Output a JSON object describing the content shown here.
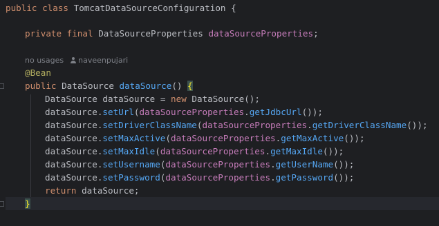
{
  "code": {
    "line1": {
      "kw_public": "public",
      "kw_class": "class",
      "class_name": "TomcatDataSourceConfiguration",
      "brace": "{"
    },
    "line2": {
      "kw_private": "private",
      "kw_final": "final",
      "type": "DataSourceProperties",
      "field": "dataSourceProperties",
      "semi": ";"
    },
    "hint": {
      "usages": "no usages",
      "author": "naveenpujari",
      "author_icon": "person-icon"
    },
    "annotation": "@Bean",
    "method_sig": {
      "kw_public": "public",
      "return_type": "DataSource",
      "method_name": "dataSource",
      "parens": "()",
      "brace": "{"
    },
    "decl": {
      "type": "DataSource",
      "var": "dataSource",
      "eq": "=",
      "kw_new": "new",
      "ctor": "DataSource();"
    },
    "calls": [
      {
        "prefix": "dataSource.",
        "method": "setUrl",
        "open": "(",
        "arg_field": "dataSourceProperties",
        "dot": ".",
        "getter": "getJdbcUrl",
        "close": "());"
      },
      {
        "prefix": "dataSource.",
        "method": "setDriverClassName",
        "open": "(",
        "arg_field": "dataSourceProperties",
        "dot": ".",
        "getter": "getDriverClassName",
        "close": "());"
      },
      {
        "prefix": "dataSource.",
        "method": "setMaxActive",
        "open": "(",
        "arg_field": "dataSourceProperties",
        "dot": ".",
        "getter": "getMaxActive",
        "close": "());"
      },
      {
        "prefix": "dataSource.",
        "method": "setMaxIdle",
        "open": "(",
        "arg_field": "dataSourceProperties",
        "dot": ".",
        "getter": "getMaxIdle",
        "close": "());"
      },
      {
        "prefix": "dataSource.",
        "method": "setUsername",
        "open": "(",
        "arg_field": "dataSourceProperties",
        "dot": ".",
        "getter": "getUserName",
        "close": "());"
      },
      {
        "prefix": "dataSource.",
        "method": "setPassword",
        "open": "(",
        "arg_field": "dataSourceProperties",
        "dot": ".",
        "getter": "getPassword",
        "close": "());"
      }
    ],
    "ret": {
      "kw_return": "return",
      "value": "dataSource;"
    },
    "closing_brace": "}"
  },
  "colors": {
    "background": "#1e1f22",
    "keyword": "#cf8e6d",
    "method": "#56a8f5",
    "field": "#c77dbb",
    "annotation": "#b3ae60",
    "text": "#bcbec4"
  }
}
